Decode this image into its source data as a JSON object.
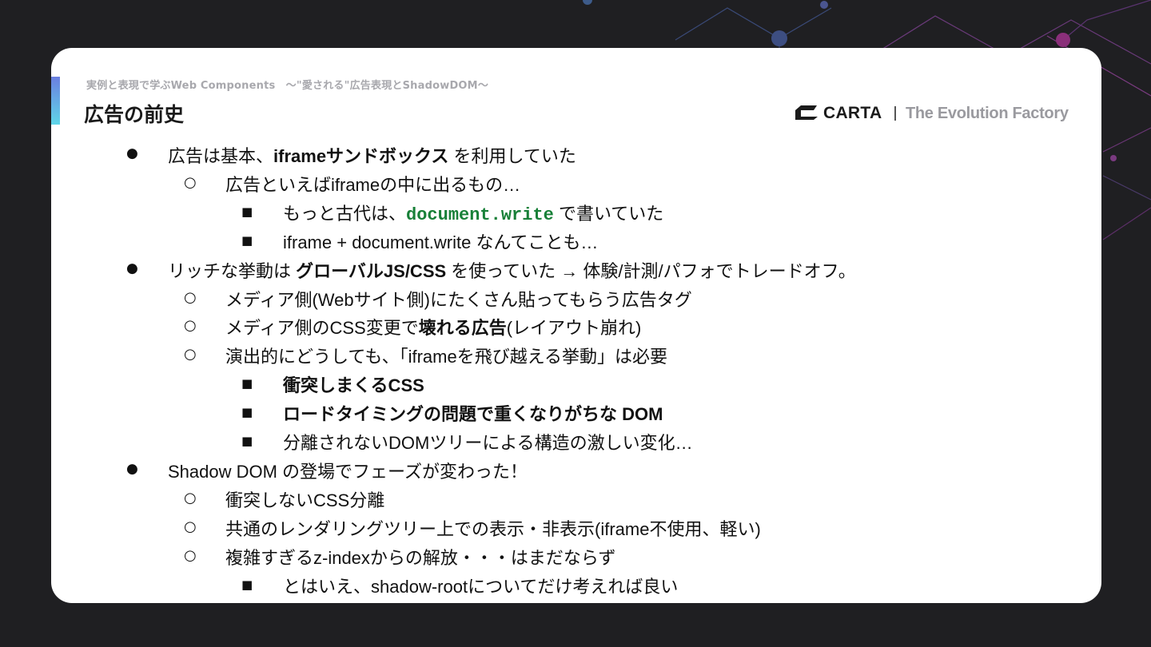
{
  "header": {
    "subtitle": "実例と表現で学ぶWeb Components　〜\"愛される\"広告表現とShadowDOM〜",
    "title": "広告の前史"
  },
  "logo": {
    "name": "CARTA",
    "tagline": "The Evolution Factory"
  },
  "bullets": {
    "l1": "●",
    "l2": "○",
    "l3": "■"
  },
  "items": [
    {
      "level": 1,
      "parts": [
        {
          "t": "広告は基本、"
        },
        {
          "t": "iframeサンドボックス",
          "s": "b"
        },
        {
          "t": " を利用していた"
        }
      ]
    },
    {
      "level": 2,
      "parts": [
        {
          "t": "広告といえばiframeの中に出るもの…"
        }
      ]
    },
    {
      "level": 3,
      "parts": [
        {
          "t": "もっと古代は、"
        },
        {
          "t": "document.write",
          "s": "code"
        },
        {
          "t": " で書いていた"
        }
      ]
    },
    {
      "level": 3,
      "parts": [
        {
          "t": "iframe + document.write なんてことも…"
        }
      ]
    },
    {
      "level": 1,
      "parts": [
        {
          "t": "リッチな挙動は "
        },
        {
          "t": "グローバルJS/CSS",
          "s": "b"
        },
        {
          "t": " を使っていた → 体験/計測/パフォでトレードオフ。"
        }
      ]
    },
    {
      "level": 2,
      "parts": [
        {
          "t": "メディア側(Webサイト側)にたくさん貼ってもらう広告タグ"
        }
      ]
    },
    {
      "level": 2,
      "parts": [
        {
          "t": "メディア側のCSS変更で"
        },
        {
          "t": "壊れる広告",
          "s": "b"
        },
        {
          "t": "(レイアウト崩れ)"
        }
      ]
    },
    {
      "level": 2,
      "parts": [
        {
          "t": "演出的にどうしても、「iframeを飛び越える挙動」は必要"
        }
      ]
    },
    {
      "level": 3,
      "parts": [
        {
          "t": "衝突しまくるCSS",
          "s": "b"
        }
      ]
    },
    {
      "level": 3,
      "parts": [
        {
          "t": "ロードタイミングの問題で重くなりがちな DOM",
          "s": "b"
        }
      ]
    },
    {
      "level": 3,
      "parts": [
        {
          "t": "分離されないDOMツリーによる構造の激しい変化…"
        }
      ]
    },
    {
      "level": 1,
      "parts": [
        {
          "t": "Shadow DOM の登場でフェーズが変わった！"
        }
      ]
    },
    {
      "level": 2,
      "parts": [
        {
          "t": "衝突しないCSS分離"
        }
      ]
    },
    {
      "level": 2,
      "parts": [
        {
          "t": "共通のレンダリングツリー上での表示・非表示(iframe不使用、軽い)"
        }
      ]
    },
    {
      "level": 2,
      "parts": [
        {
          "t": "複雑すぎるz-indexからの解放・・・はまだならず"
        }
      ]
    },
    {
      "level": 3,
      "parts": [
        {
          "t": "とはいえ、shadow-rootについてだけ考えれば良い"
        }
      ]
    }
  ]
}
